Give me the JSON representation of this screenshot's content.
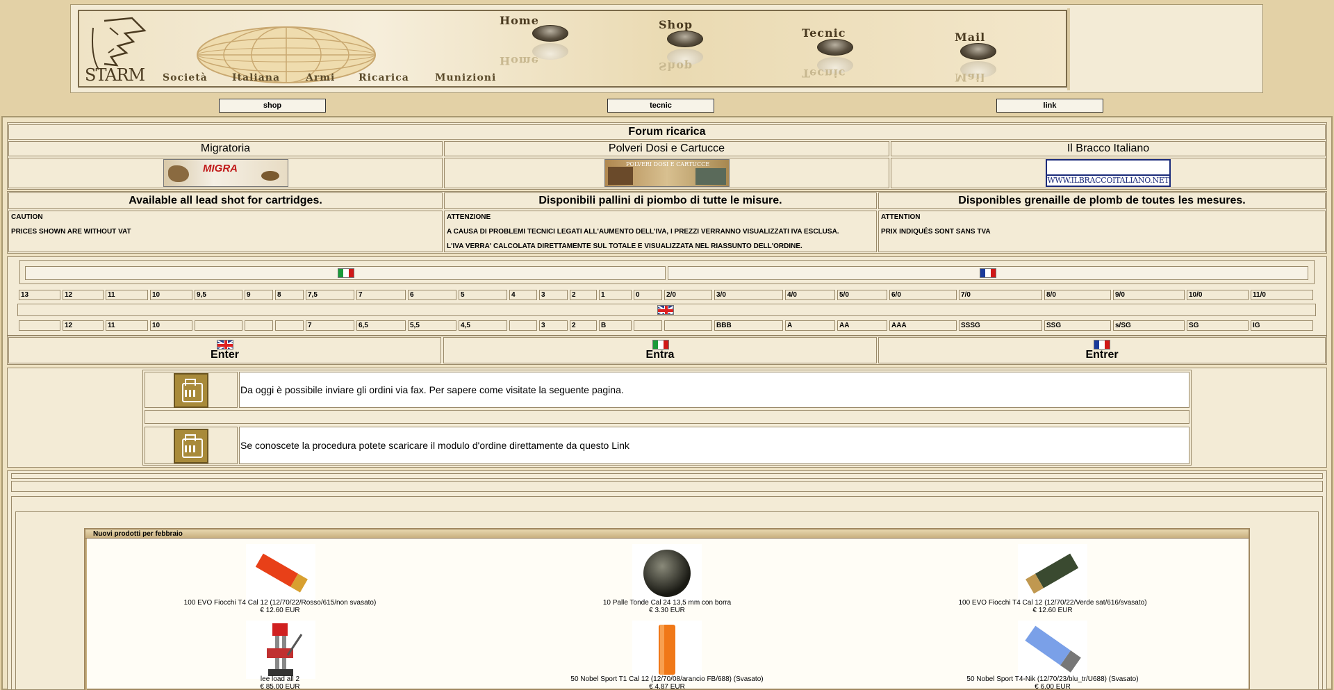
{
  "header": {
    "logo_text": "STARM",
    "nav": {
      "home": "Home",
      "shop": "Shop",
      "tecnic": "Tecnic",
      "mail": "Mail"
    },
    "subtitle": [
      "Società",
      "Italiana",
      "Armi",
      "Ricarica",
      "Munizioni"
    ]
  },
  "buttons": {
    "shop": "shop",
    "tecnic": "tecnic",
    "link": "link"
  },
  "forum": {
    "title": "Forum ricarica",
    "links": [
      {
        "label": "Migratoria",
        "banner_text": "MIGRA"
      },
      {
        "label": "Polveri Dosi e Cartucce",
        "banner_text": "POLVERI DOSI E CARTUCCE"
      },
      {
        "label": "Il Bracco Italiano",
        "banner_text": "WWW.ILBRACCOITALIANO.NET"
      }
    ]
  },
  "notices": [
    {
      "title": "Available all lead shot for cartridges.",
      "lines": [
        "CAUTION",
        "PRICES SHOWN ARE WITHOUT VAT"
      ]
    },
    {
      "title": "Disponibili pallini di piombo di tutte le misure.",
      "lines": [
        "ATTENZIONE",
        "A CAUSA DI PROBLEMI TECNICI LEGATI ALL'AUMENTO DELL'IVA, I PREZZI VERRANNO VISUALIZZATI IVA ESCLUSA.",
        "L'IVA VERRA' CALCOLATA DIRETTAMENTE SUL TOTALE E VISUALIZZATA NEL RIASSUNTO DELL'ORDINE."
      ]
    },
    {
      "title": "Disponibles grenaille de plomb de toutes les mesures.",
      "lines": [
        "ATTENTION",
        "PRIX INDIQUÉS SONT SANS TVA"
      ]
    }
  ],
  "shot_sizes": {
    "italian_french": [
      "13",
      "12",
      "11",
      "10",
      "9,5",
      "9",
      "8",
      "7,5",
      "7",
      "6",
      "5",
      "4",
      "3",
      "2",
      "1",
      "0",
      "2/0",
      "3/0",
      "4/0",
      "5/0",
      "6/0",
      "7/0",
      "8/0",
      "9/0",
      "10/0",
      "11/0"
    ],
    "english": [
      "",
      "12",
      "11",
      "10",
      "",
      "",
      "",
      "7",
      "6,5",
      "5,5",
      "4,5",
      "",
      "3",
      "2",
      "B",
      "",
      "",
      "BBB",
      "A",
      "AA",
      "AAA",
      "SSSG",
      "SSG",
      "s/SG",
      "SG",
      "IG"
    ]
  },
  "enter": {
    "en": "Enter",
    "it": "Entra",
    "fr": "Entrer"
  },
  "fax": {
    "line1": "Da oggi è possibile inviare gli ordini via fax. Per sapere come visitate la seguente pagina.",
    "line2": "Se conoscete la procedura potete scaricare il modulo d'ordine direttamente da questo Link"
  },
  "new_products": {
    "title": "Nuovi prodotti per febbraio",
    "items": [
      {
        "name": "100 EVO Fiocchi T4 Cal 12 (12/70/22/Rosso/615/non svasato)",
        "price": "€ 12.60 EUR",
        "image": "red-shotshell"
      },
      {
        "name": "10 Palle Tonde Cal 24 13,5 mm con borra",
        "price": "€ 3.30 EUR",
        "image": "lead-ball"
      },
      {
        "name": "100 EVO Fiocchi T4 Cal 12 (12/70/22/Verde sat/616/svasato)",
        "price": "€ 12.60 EUR",
        "image": "green-shotshell"
      },
      {
        "name": "lee load all 2",
        "price": "€ 85.00 EUR",
        "image": "reloading-press"
      },
      {
        "name": "50 Nobel Sport T1 Cal 12 (12/70/08/arancio FB/688) (Svasato)",
        "price": "€ 4.87 EUR",
        "image": "orange-hull"
      },
      {
        "name": "50 Nobel Sport T4-Nik (12/70/23/blu_tr/U688) (Svasato)",
        "price": "€ 6.00 EUR",
        "image": "blue-shotshell"
      }
    ]
  },
  "colors": {
    "background": "#e3d1a6",
    "panel": "#f3ebd6",
    "border": "#9a8a6a"
  }
}
